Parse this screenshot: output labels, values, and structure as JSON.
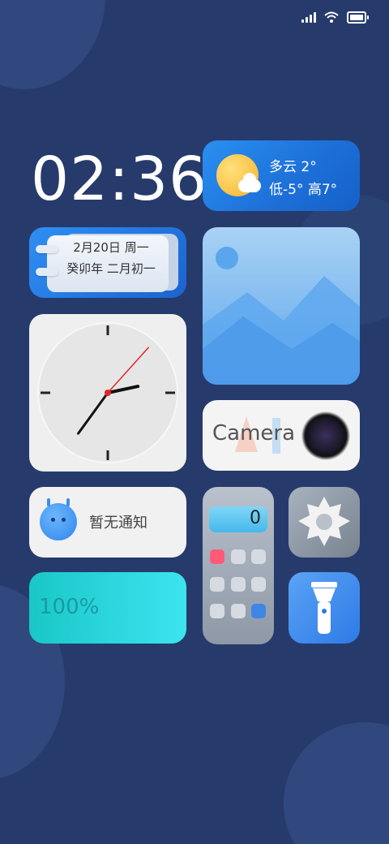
{
  "status_bar": {
    "signal_icon": "signal-icon",
    "wifi_icon": "wifi-icon",
    "battery_icon": "battery-icon"
  },
  "clock_time": "02:36",
  "weather": {
    "condition": "多云 2°",
    "range": "低-5° 高7°",
    "icon": "partly-cloudy-icon"
  },
  "calendar": {
    "line1": "2月20日 周一",
    "line2": "癸卯年 二月初一"
  },
  "analog_clock": {
    "hour": 2,
    "minute": 36,
    "second": 7
  },
  "camera_widget": {
    "label": "Camera"
  },
  "notification_widget": {
    "text": "暂无通知"
  },
  "calculator_widget": {
    "display": "0"
  },
  "battery_widget": {
    "percent_text": "100%",
    "level": 1.0
  },
  "colors": {
    "background": "#263b6b",
    "accent_blue": "#1d6fd8",
    "battery_teal": "#19c7c7"
  }
}
